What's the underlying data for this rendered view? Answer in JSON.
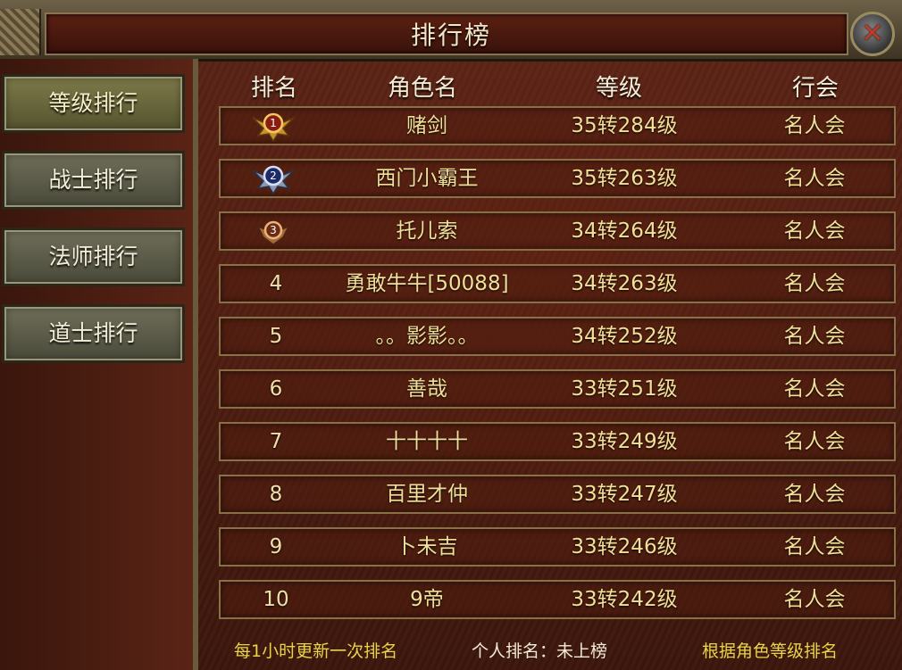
{
  "window": {
    "title": "排行榜",
    "close_icon": "close-icon"
  },
  "sidebar": {
    "items": [
      {
        "label": "等级排行",
        "active": true
      },
      {
        "label": "战士排行",
        "active": false
      },
      {
        "label": "法师排行",
        "active": false
      },
      {
        "label": "道士排行",
        "active": false
      }
    ]
  },
  "table": {
    "headers": {
      "rank": "排名",
      "name": "角色名",
      "level": "等级",
      "guild": "行会"
    },
    "rows": [
      {
        "rank": "1",
        "medal": "gold-medal-icon",
        "name": "赌剑",
        "level": "35转284级",
        "guild": "名人会"
      },
      {
        "rank": "2",
        "medal": "silver-medal-icon",
        "name": "西门小霸王",
        "level": "35转263级",
        "guild": "名人会"
      },
      {
        "rank": "3",
        "medal": "bronze-medal-icon",
        "name": "托儿索",
        "level": "34转264级",
        "guild": "名人会"
      },
      {
        "rank": "4",
        "name": "勇敢牛牛[50088]",
        "level": "34转263级",
        "guild": "名人会"
      },
      {
        "rank": "5",
        "name": "。。影影。。",
        "level": "34转252级",
        "guild": "名人会"
      },
      {
        "rank": "6",
        "name": "善哉",
        "level": "33转251级",
        "guild": "名人会"
      },
      {
        "rank": "7",
        "name": "十十十十",
        "level": "33转249级",
        "guild": "名人会"
      },
      {
        "rank": "8",
        "name": "百里才仲",
        "level": "33转247级",
        "guild": "名人会"
      },
      {
        "rank": "9",
        "name": "卜未吉",
        "level": "33转246级",
        "guild": "名人会"
      },
      {
        "rank": "10",
        "name": "9帝",
        "level": "33转242级",
        "guild": "名人会"
      }
    ]
  },
  "footer": {
    "update_note": "每1小时更新一次排名",
    "personal_rank": "个人排名：未上榜",
    "sort_note": "根据角色等级排名"
  }
}
